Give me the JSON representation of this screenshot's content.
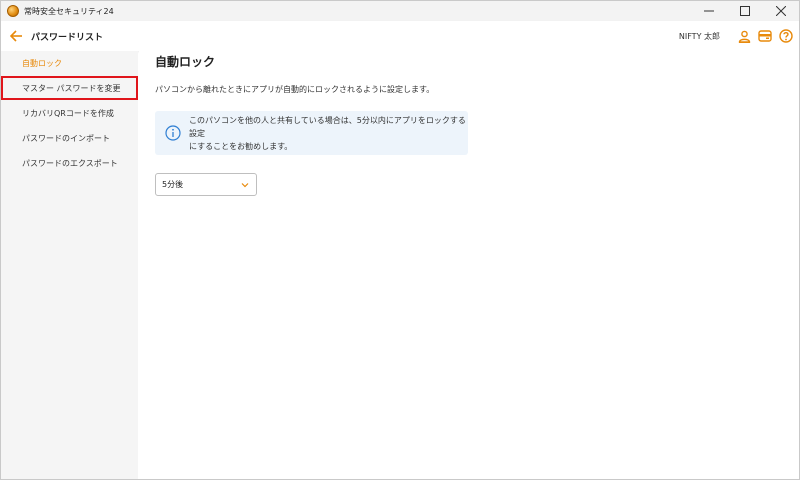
{
  "window": {
    "title": "常時安全セキュリティ24"
  },
  "header": {
    "page_title": "パスワードリスト",
    "user_name": "NIFTY 太郎",
    "icons": [
      "back-arrow-icon",
      "user-icon",
      "wallet-icon",
      "help-icon"
    ]
  },
  "sidebar": {
    "items": [
      {
        "label": "自動ロック",
        "state": "active"
      },
      {
        "label": "マスター パスワードを変更",
        "state": "highlighted"
      },
      {
        "label": "リカバリQRコードを作成",
        "state": "normal"
      },
      {
        "label": "パスワードのインポート",
        "state": "normal"
      },
      {
        "label": "パスワードのエクスポート",
        "state": "normal"
      }
    ]
  },
  "main": {
    "title": "自動ロック",
    "description": "パソコンから離れたときにアプリが自動的にロックされるように設定します。",
    "info": {
      "line1": "このパソコンを他の人と共有している場合は、5分以内にアプリをロックする設定",
      "line2": "にすることをお勧めします。"
    },
    "select": {
      "value": "5分後"
    }
  },
  "colors": {
    "accent": "#e88a0c",
    "highlight_border": "#e0151b",
    "info_bg": "#edf4fb",
    "info_icon": "#2f7fd3"
  }
}
